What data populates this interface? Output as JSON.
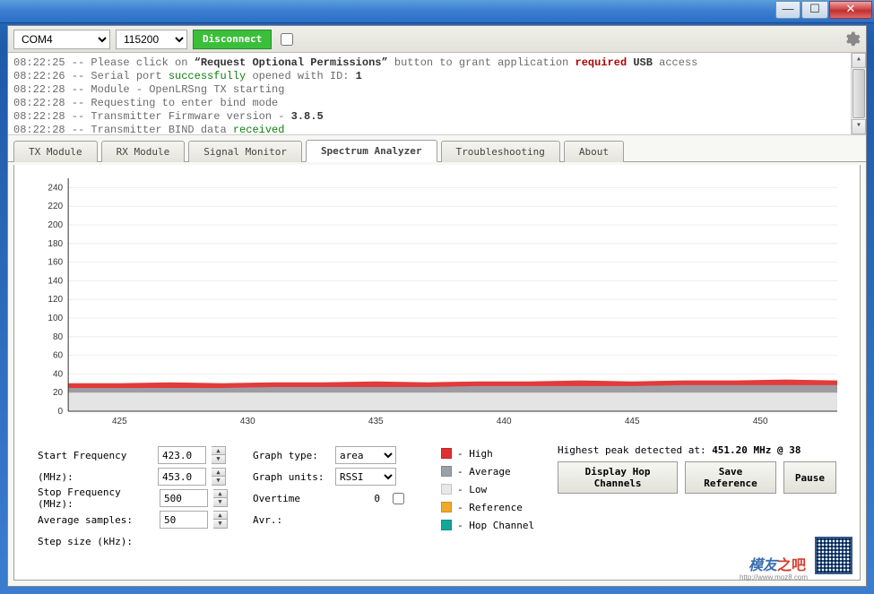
{
  "window": {
    "minimize_glyph": "—",
    "maximize_glyph": "☐",
    "close_glyph": "✕"
  },
  "toolbar": {
    "port_value": "COM4",
    "baud_value": "115200",
    "disconnect_label": "Disconnect"
  },
  "log": {
    "lines": [
      {
        "ts": "08:22:25",
        "parts": [
          "-- Please click on ",
          {
            "b": "“Request Optional Permissions”"
          },
          " button to grant application ",
          {
            "r": "required"
          },
          " ",
          {
            "b": "USB"
          },
          " access"
        ]
      },
      {
        "ts": "08:22:26",
        "parts": [
          "-- Serial port ",
          {
            "g": "successfully"
          },
          " opened with ID: ",
          {
            "b": "1"
          }
        ]
      },
      {
        "ts": "08:22:28",
        "parts": [
          "-- Module - OpenLRSng TX starting"
        ]
      },
      {
        "ts": "08:22:28",
        "parts": [
          "-- Requesting to enter bind mode"
        ]
      },
      {
        "ts": "08:22:28",
        "parts": [
          "-- Transmitter Firmware version - ",
          {
            "b": "3.8.5"
          }
        ]
      },
      {
        "ts": "08:22:28",
        "parts": [
          "-- Transmitter BIND data ",
          {
            "g": "received"
          }
        ]
      }
    ]
  },
  "tabs": {
    "items": [
      {
        "label": "TX Module"
      },
      {
        "label": "RX Module"
      },
      {
        "label": "Signal Monitor"
      },
      {
        "label": "Spectrum Analyzer"
      },
      {
        "label": "Troubleshooting"
      },
      {
        "label": "About"
      }
    ],
    "active_index": 3
  },
  "chart_data": {
    "type": "area",
    "xlabel": "",
    "ylabel": "",
    "xlim": [
      423,
      453
    ],
    "ylim": [
      0,
      250
    ],
    "x_ticks": [
      425,
      430,
      435,
      440,
      445,
      450
    ],
    "y_ticks": [
      0,
      20,
      40,
      60,
      80,
      100,
      120,
      140,
      160,
      180,
      200,
      220,
      240
    ],
    "x": [
      423,
      425,
      427,
      429,
      431,
      433,
      435,
      437,
      439,
      441,
      443,
      445,
      447,
      449,
      451,
      453
    ],
    "series": [
      {
        "name": "High",
        "color": "#e03030",
        "values": [
          30,
          30,
          31,
          30,
          31,
          31,
          32,
          31,
          32,
          32,
          33,
          32,
          33,
          33,
          34,
          33
        ]
      },
      {
        "name": "Average",
        "color": "#9aa0a8",
        "values": [
          25,
          25,
          25,
          25,
          26,
          26,
          26,
          26,
          27,
          27,
          27,
          27,
          28,
          28,
          28,
          28
        ]
      },
      {
        "name": "Low",
        "color": "#e8e8e8",
        "values": [
          20,
          20,
          20,
          20,
          20,
          20,
          20,
          20,
          20,
          20,
          20,
          20,
          20,
          20,
          20,
          20
        ]
      }
    ]
  },
  "controls": {
    "start_freq_label": "Start Frequency (MHz):",
    "start_freq_value": "423.0",
    "start_freq_value2": "453.0",
    "stop_freq_label": "Stop Frequency (MHz):",
    "stop_freq_value": "500",
    "avg_samples_label": "Average samples:",
    "avg_samples_value": "50",
    "step_size_label": "Step size (kHz):",
    "graph_type_label": "Graph type:",
    "graph_type_value": "area",
    "graph_units_label": "Graph units:",
    "graph_units_value": "RSSI",
    "overtime_label": "Overtime",
    "overtime_value": "0",
    "avr_label": "Avr.:"
  },
  "legend": {
    "items": [
      {
        "label": "High",
        "color": "#e03030"
      },
      {
        "label": "Average",
        "color": "#9aa0a8"
      },
      {
        "label": "Low",
        "color": "#e8e8e8"
      },
      {
        "label": "Reference",
        "color": "#f0a828"
      },
      {
        "label": "Hop Channel",
        "color": "#10a89a"
      }
    ],
    "sep": " - "
  },
  "info": {
    "peak_prefix": "Highest peak detected at: ",
    "peak_value": "451.20 MHz @ 38",
    "btn_display": "Display Hop Channels",
    "btn_saveref": "Save Reference",
    "btn_pause": "Pause"
  },
  "watermark": {
    "t1": "模友",
    "t2": "之吧",
    "url": "http://www.moz8.com"
  }
}
